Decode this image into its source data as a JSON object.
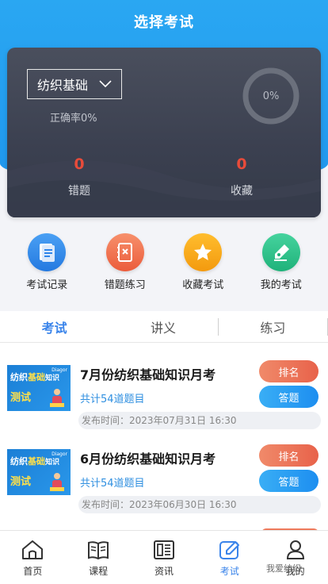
{
  "header": {
    "title": "选择考试"
  },
  "stats": {
    "subject": "纺织基础",
    "accuracy": "正确率0%",
    "progress_text": "0%",
    "progress_value": 0,
    "wrong_count": "0",
    "wrong_label": "错题",
    "fav_count": "0",
    "fav_label": "收藏"
  },
  "quick_actions": [
    {
      "label": "考试记录",
      "icon": "document-icon",
      "color": "#2f86ea"
    },
    {
      "label": "错题练习",
      "icon": "wrong-book-icon",
      "color": "#f0714e"
    },
    {
      "label": "收藏考试",
      "icon": "star-icon",
      "color": "#f6a81a"
    },
    {
      "label": "我的考试",
      "icon": "pen-icon",
      "color": "#2dc18a"
    }
  ],
  "tabs": [
    {
      "label": "考试",
      "active": true
    },
    {
      "label": "讲义",
      "active": false
    },
    {
      "label": "练习",
      "active": false
    }
  ],
  "exams": [
    {
      "title": "7月份纺织基础知识月考",
      "count": "共计54道题目",
      "date": "发布时间：2023年07月31日 16:30",
      "rank_label": "排名",
      "answer_label": "答题",
      "thumb_line1a": "纺织",
      "thumb_line1b": "基础",
      "thumb_line1c": "知识",
      "thumb_line2": "测试",
      "thumb_logo": "Diagor"
    },
    {
      "title": "6月份纺织基础知识月考",
      "count": "共计54道题目",
      "date": "发布时间：2023年06月30日 16:30",
      "rank_label": "排名",
      "answer_label": "答题",
      "thumb_line1a": "纺织",
      "thumb_line1b": "基础",
      "thumb_line1c": "知识",
      "thumb_line2": "测试",
      "thumb_logo": "Diagor"
    }
  ],
  "bottom_nav": [
    {
      "label": "首页",
      "icon": "home-icon",
      "active": false
    },
    {
      "label": "课程",
      "icon": "book-icon",
      "active": false
    },
    {
      "label": "资讯",
      "icon": "news-icon",
      "active": false
    },
    {
      "label": "考试",
      "icon": "exam-edit-icon",
      "active": true
    },
    {
      "label": "我的",
      "icon": "profile-icon",
      "active": false
    }
  ],
  "watermark": "我爱纺织",
  "colors": {
    "primary": "#2aa7f2",
    "accent_blue": "#3a84ea",
    "rank_red": "#e8624a",
    "stat_red": "#e84b3a"
  }
}
